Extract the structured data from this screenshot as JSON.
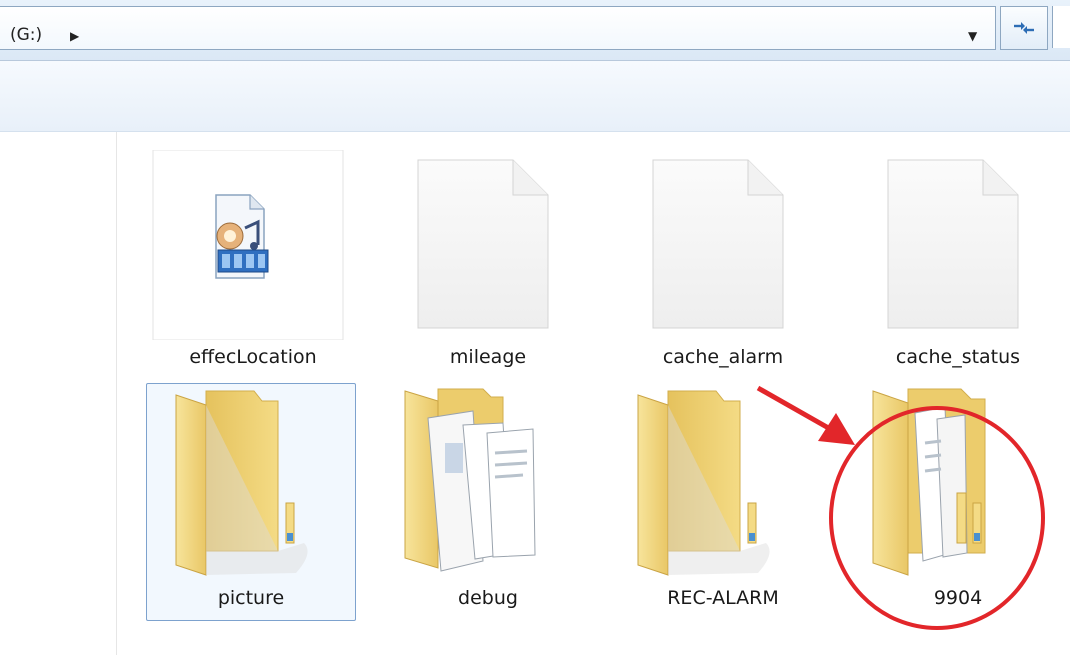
{
  "address_bar": {
    "path": "(G:)",
    "crumb_icon": "chevron-right-icon",
    "dropdown_icon": "chevron-down-icon",
    "refresh_icon": "refresh-icon"
  },
  "files": [
    {
      "name": "effecLocation",
      "icon": "media-file-icon"
    },
    {
      "name": "mileage",
      "icon": "blank-file-icon"
    },
    {
      "name": "cache_alarm",
      "icon": "blank-file-icon"
    },
    {
      "name": "cache_status",
      "icon": "blank-file-icon"
    },
    {
      "name": "picture",
      "icon": "empty-folder-icon",
      "selected": true
    },
    {
      "name": "debug",
      "icon": "documents-folder-icon"
    },
    {
      "name": "REC-ALARM",
      "icon": "empty-folder-icon"
    },
    {
      "name": "9904",
      "icon": "documents-folder-icon",
      "highlighted": true
    }
  ],
  "colors": {
    "folder_yellow": "#f2d779",
    "folder_shadow": "#d9b54a",
    "selection_border": "#7da2ce",
    "annotation_red": "#e2262a"
  }
}
